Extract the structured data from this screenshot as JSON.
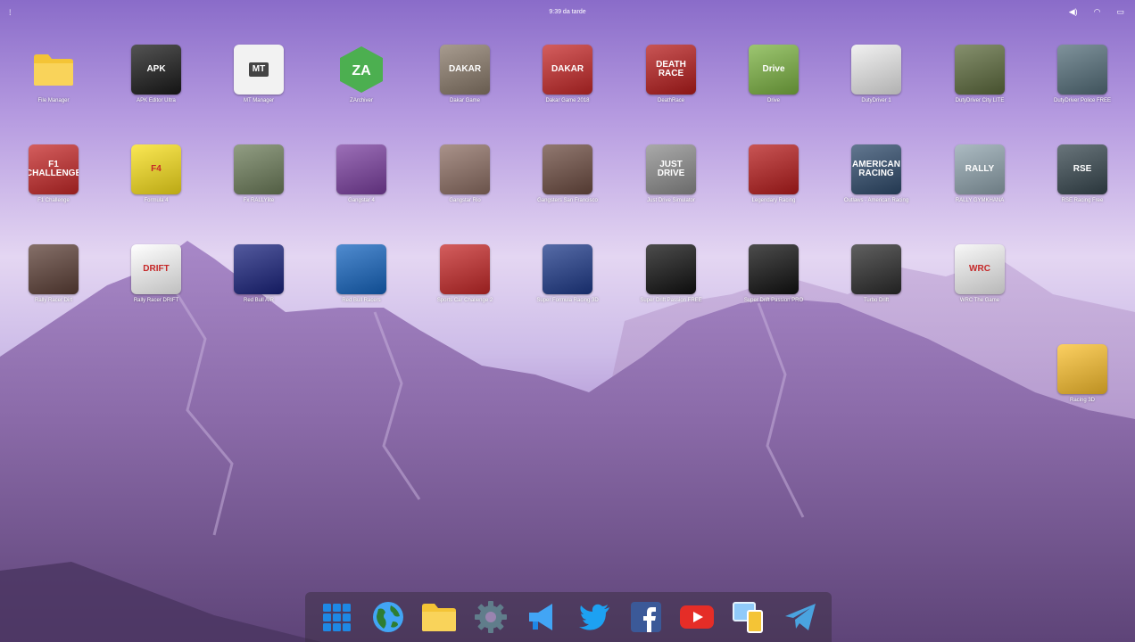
{
  "topbar": {
    "clock": "9:39 da tarde",
    "menu_icon": "dots-menu-icon",
    "tray_icons": [
      "volume-icon",
      "wifi-icon",
      "battery-icon"
    ]
  },
  "apps": [
    {
      "label": "File Manager",
      "icon": "folder-icon",
      "color": "#f4c436",
      "text": ""
    },
    {
      "label": "APK Editor Ultra",
      "icon": "apk-editor-icon",
      "color": "#1a1a1a",
      "text": "APK"
    },
    {
      "label": "MT Manager",
      "icon": "mt-manager-icon",
      "color": "#f2f2f2",
      "text": "MT"
    },
    {
      "label": "ZArchiver",
      "icon": "zarchiver-icon",
      "color": "#4caf50",
      "text": "ZA"
    },
    {
      "label": "Dakar Game",
      "icon": "dakar-game-icon",
      "color": "#8a7a6a",
      "text": "DAKAR"
    },
    {
      "label": "Dakar Game 2018",
      "icon": "dakar-2018-icon",
      "color": "#c62828",
      "text": "DAKAR"
    },
    {
      "label": "DeathRace",
      "icon": "deathrace-icon",
      "color": "#b71c1c",
      "text": "DEATH RACE"
    },
    {
      "label": "Drive",
      "icon": "drive-icon",
      "color": "#7cb342",
      "text": "Drive"
    },
    {
      "label": "DutyDriver 1",
      "icon": "dutydriver-icon",
      "color": "#ececec",
      "text": ""
    },
    {
      "label": "DutyDriver City LITE",
      "icon": "dutydriver-city-icon",
      "color": "#5d6b3d",
      "text": ""
    },
    {
      "label": "DutyDriver Police FREE",
      "icon": "dutydriver-police-icon",
      "color": "#546e7a",
      "text": ""
    },
    {
      "label": "F1 Challenge",
      "icon": "f1-challenge-icon",
      "color": "#c62828",
      "text": "F1 CHALLENGE"
    },
    {
      "label": "Formula 4",
      "icon": "formula4-icon",
      "color": "#f9e01b",
      "text": "F4"
    },
    {
      "label": "Fx RALLYlite",
      "icon": "fx-rally-icon",
      "color": "#6d7d5a",
      "text": ""
    },
    {
      "label": "Gangstar 4",
      "icon": "gangstar4-icon",
      "color": "#7b3fa0",
      "text": ""
    },
    {
      "label": "Gangstar Rio",
      "icon": "gangstar-rio-icon",
      "color": "#8d6e63",
      "text": ""
    },
    {
      "label": "Gangsters San Francisco",
      "icon": "gangsters-sf-icon",
      "color": "#6d4c41",
      "text": ""
    },
    {
      "label": "Just Drive Simulator",
      "icon": "just-drive-icon",
      "color": "#8d8d8d",
      "text": "JUST DRIVE"
    },
    {
      "label": "Legendary Racing",
      "icon": "legendary-racing-icon",
      "color": "#b71c1c",
      "text": ""
    },
    {
      "label": "Outlaws - American Racing",
      "icon": "outlaws-icon",
      "color": "#2e4a6b",
      "text": "AMERICAN RACING"
    },
    {
      "label": "RALLY GYMKHANA",
      "icon": "rally-gymkhana-icon",
      "color": "#90a4ae",
      "text": "RALLY"
    },
    {
      "label": "RSE Racing Free",
      "icon": "rse-racing-icon",
      "color": "#37474f",
      "text": "RSE"
    },
    {
      "label": "Rally Racer Dirt",
      "icon": "rally-racer-icon",
      "color": "#5d4037",
      "text": ""
    },
    {
      "label": "Rally Racer DRIFT",
      "icon": "rally-drift-icon",
      "color": "#ffffff",
      "text": "DRIFT"
    },
    {
      "label": "Red Bull AIR",
      "icon": "red-bull-air-icon",
      "color": "#1a237e",
      "text": ""
    },
    {
      "label": "Red Bull Racers",
      "icon": "red-bull-racers-icon",
      "color": "#1565c0",
      "text": ""
    },
    {
      "label": "Sports Car Challenge 2",
      "icon": "sports-car-icon",
      "color": "#c62828",
      "text": ""
    },
    {
      "label": "Super Formula Racing 3D",
      "icon": "super-formula-icon",
      "color": "#1e3a8a",
      "text": ""
    },
    {
      "label": "Super Drift Passion FREE",
      "icon": "super-drift-free-icon",
      "color": "#111111",
      "text": ""
    },
    {
      "label": "Super Drift Passion PRO",
      "icon": "super-drift-pro-icon",
      "color": "#111111",
      "text": ""
    },
    {
      "label": "Turbo Drift",
      "icon": "turbo-drift-icon",
      "color": "#2b2b2b",
      "text": ""
    },
    {
      "label": "WRC The Game",
      "icon": "wrc-icon",
      "color": "#f5f5f5",
      "text": "WRC"
    },
    {
      "label": "Racing 3D",
      "icon": "racing-3d-icon",
      "color": "#fbc02d",
      "text": ""
    }
  ],
  "dock": [
    {
      "icon": "app-grid-icon",
      "color": "#1e88e5"
    },
    {
      "icon": "globe-icon",
      "color": "#2e7d32"
    },
    {
      "icon": "folder-icon",
      "color": "#f4c436"
    },
    {
      "icon": "settings-gear-icon",
      "color": "#607d8b"
    },
    {
      "icon": "megaphone-icon",
      "color": "#42a5f5"
    },
    {
      "icon": "twitter-icon",
      "color": "#1da1f2"
    },
    {
      "icon": "facebook-icon",
      "color": "#3b5998"
    },
    {
      "icon": "youtube-icon",
      "color": "#e52d27"
    },
    {
      "icon": "devices-icon",
      "color": "#90caf9"
    },
    {
      "icon": "telegram-icon",
      "color": "#4aa3df"
    }
  ]
}
